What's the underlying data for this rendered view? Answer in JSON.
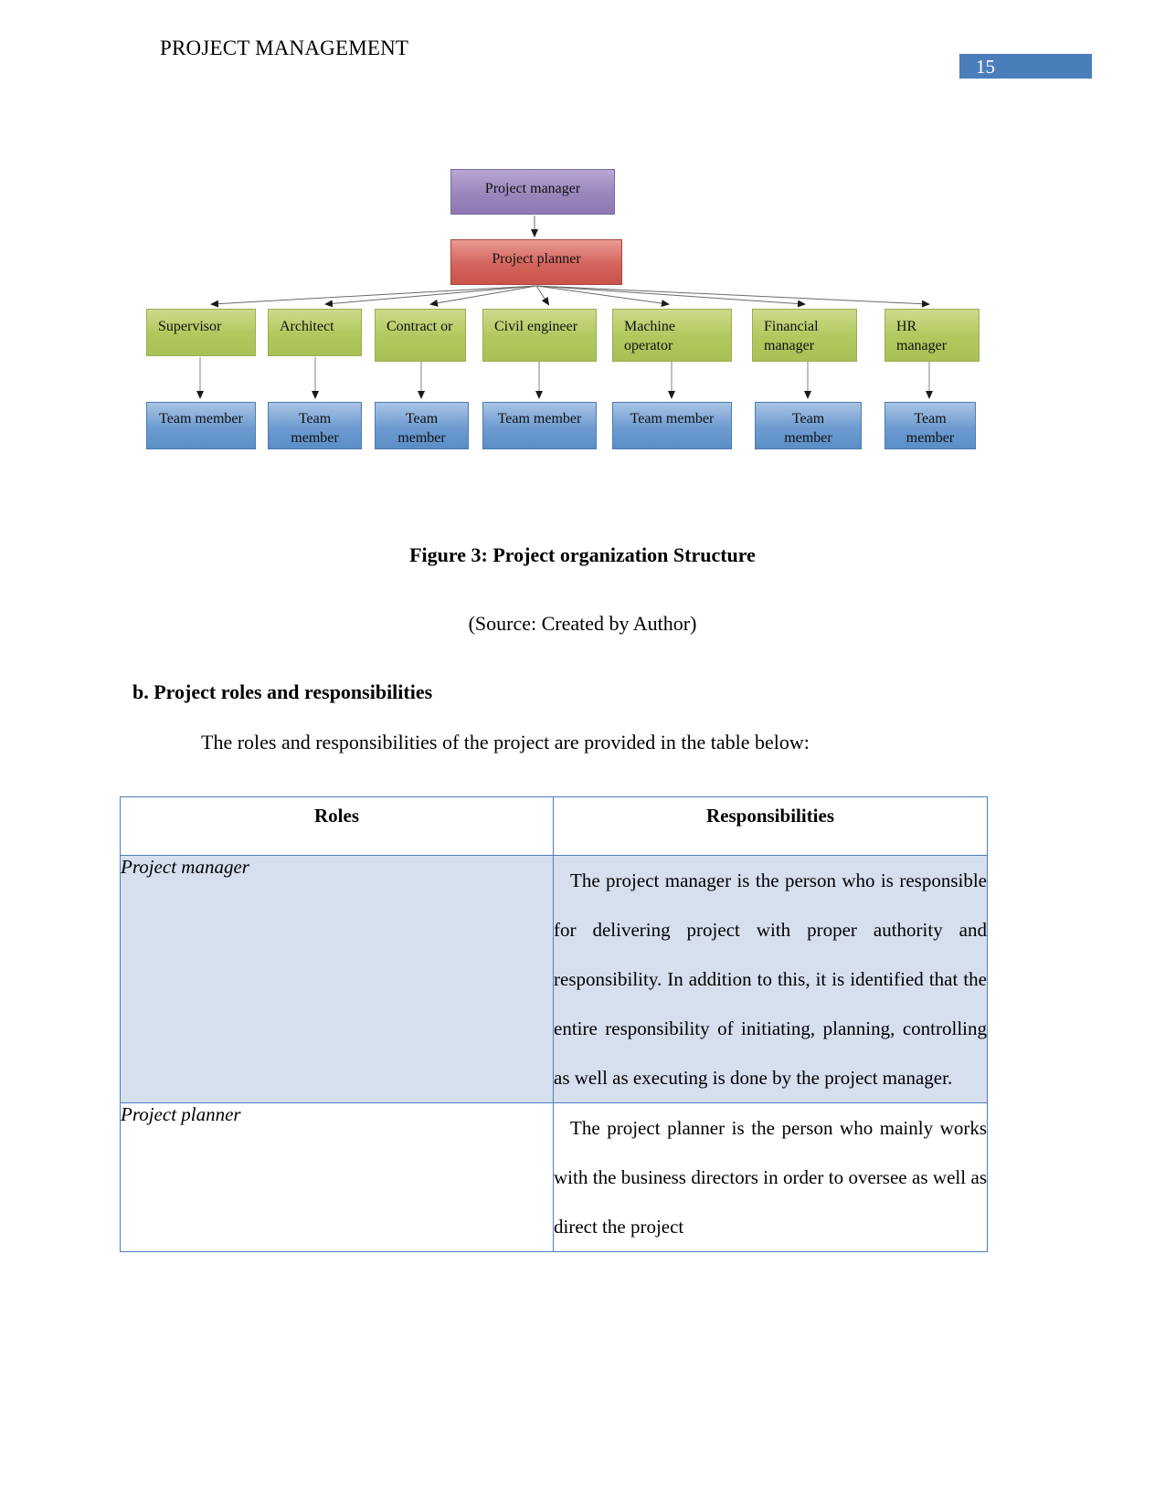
{
  "header": {
    "document_title": "PROJECT MANAGEMENT",
    "page_number": "15",
    "badge_color": "#4a7ebb"
  },
  "org_chart": {
    "top_node": {
      "label": "Project manager",
      "color": "#9b86bd"
    },
    "second_node": {
      "label": "Project planner",
      "color": "#d4645c"
    },
    "role_nodes": [
      {
        "label": "Supervisor"
      },
      {
        "label": "Architect"
      },
      {
        "label": "Contract or"
      },
      {
        "label": "Civil engineer"
      },
      {
        "label": "Machine operator"
      },
      {
        "label": "Financial manager"
      },
      {
        "label": "HR manager"
      }
    ],
    "role_node_color": "#b3c95f",
    "team_nodes": [
      {
        "label": "Team member"
      },
      {
        "label": "Team member"
      },
      {
        "label": "Team member"
      },
      {
        "label": "Team member"
      },
      {
        "label": "Team member"
      },
      {
        "label": "Team member"
      },
      {
        "label": "Team member"
      }
    ],
    "team_node_color": "#6d9bd1"
  },
  "figure": {
    "caption": "Figure 3: Project organization Structure",
    "source": "(Source: Created by Author)"
  },
  "body": {
    "section_heading": "b. Project roles and responsibilities",
    "intro_paragraph": "The roles and responsibilities of the project are provided in the table below:"
  },
  "table": {
    "headers": [
      "Roles",
      "Responsibilities"
    ],
    "rows": [
      {
        "role": "Project manager",
        "responsibility": "The project manager is the person who is responsible for delivering project with proper authority and responsibility. In addition to this, it is identified that the entire responsibility of initiating, planning, controlling as well as executing is done by the project manager.",
        "shaded": true
      },
      {
        "role": "Project planner",
        "responsibility": "The project planner is the person who mainly works with the business directors in order to oversee as well as direct the project",
        "shaded": false
      }
    ]
  }
}
